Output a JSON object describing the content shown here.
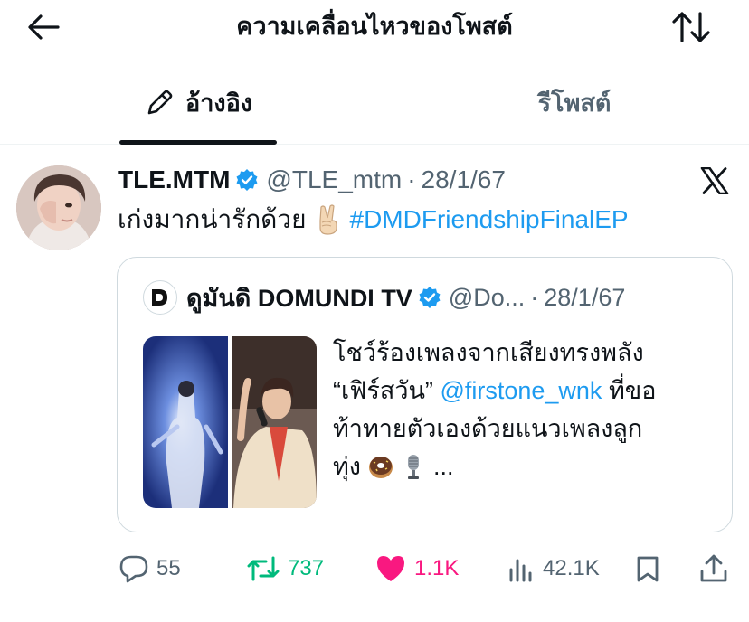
{
  "header": {
    "title": "ความเคลื่อนไหวของโพสต์",
    "back_icon": "arrow-left-icon",
    "sort_icon": "sort-arrows-icon"
  },
  "tabs": [
    {
      "label": "อ้างอิง",
      "icon": "pencil-icon",
      "active": true
    },
    {
      "label": "รีโพสต์",
      "active": false
    }
  ],
  "post": {
    "name": "TLE.MTM",
    "verified": true,
    "handle": "@TLE_mtm",
    "separator": "·",
    "date": "28/1/67",
    "text": "เก่งมากน่ารักด้วย",
    "emoji": "victory-hand-emoji",
    "hashtag": "#DMDFriendshipFinalEP",
    "source_icon": "x-logo-icon",
    "quote": {
      "name": "ดูมันดิ DOMUNDI TV",
      "verified": true,
      "handle": "@Do...",
      "separator": "·",
      "date": "28/1/67",
      "line1": "โชว์ร้องเพลงจากเสียงทรงพลัง",
      "line2_a": "“เฟิร์สวัน”",
      "line2_mention": "@firstone_wnk",
      "line2_b": "ที่ขอ",
      "line3": "ท้าทายตัวเองด้วยแนวเพลงลูก",
      "line4_a": "ทุ่ง",
      "line4_emojis": [
        "donut-emoji",
        "microphone-emoji"
      ],
      "line4_b": "..."
    },
    "stats": {
      "replies": "55",
      "reposts": "737",
      "likes": "1.1K",
      "views": "42.1K"
    }
  },
  "colors": {
    "accent": "#1d9bf0",
    "repost_active": "#00ba7c",
    "like_active": "#f91880",
    "secondary_text": "#536471",
    "border": "#cfd9de"
  }
}
